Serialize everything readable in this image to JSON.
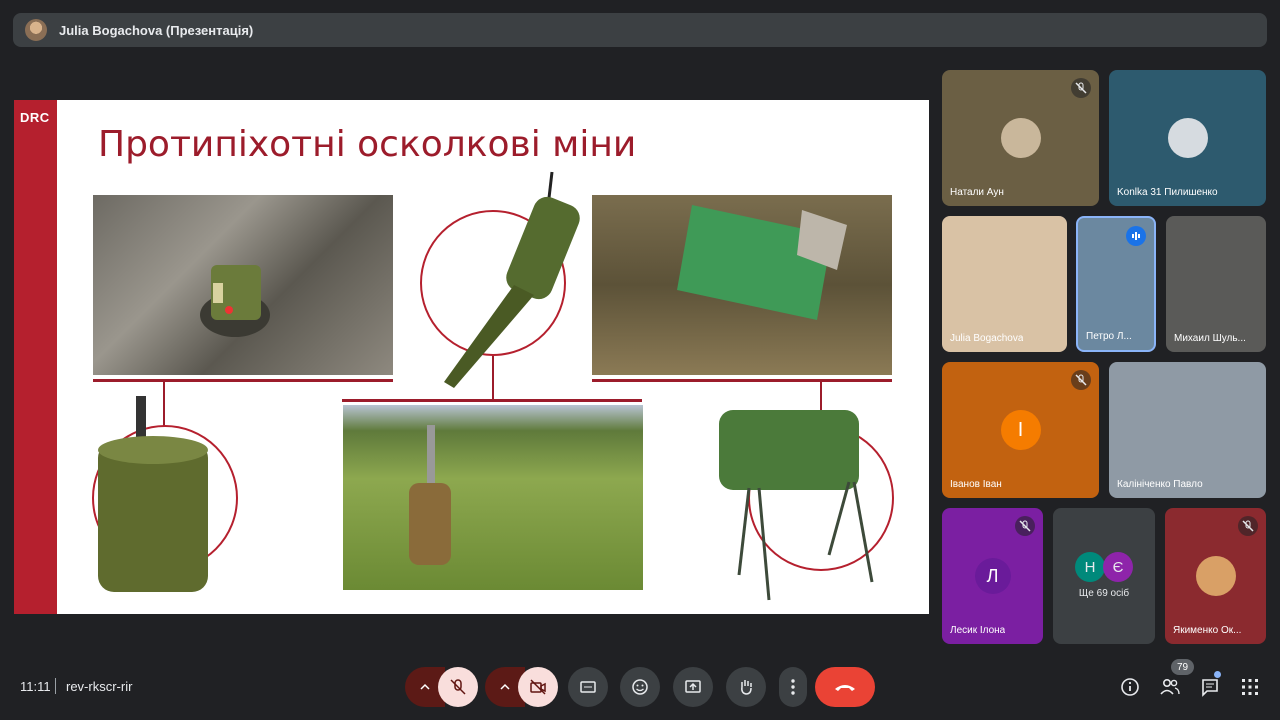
{
  "header": {
    "presenter": "Julia Bogachova (Презентація)"
  },
  "slide": {
    "logo": "DRC",
    "title": "Протипіхотні осколкові міни"
  },
  "participants": [
    {
      "name": "Натали Аун",
      "muted": true
    },
    {
      "name": "Konlka 31 Пилишенко",
      "muted": false
    },
    {
      "name": "Julia Bogachova",
      "muted": false
    },
    {
      "name": "Петро Л...",
      "speaking": true
    },
    {
      "name": "Михаил Шуль...",
      "muted": false
    },
    {
      "name": "Іванов Іван",
      "initial": "І",
      "muted": true
    },
    {
      "name": "Калініченко Павло",
      "muted": false
    },
    {
      "name": "Лесик Ілона",
      "initial": "Л",
      "muted": true
    },
    {
      "name": "Ще 69 осіб",
      "initials": [
        "Н",
        "Є"
      ]
    },
    {
      "name": "Якименко Ок...",
      "muted": true
    }
  ],
  "bottom": {
    "time": "11:11",
    "meeting_code": "rev-rkscr-rir",
    "people_count": "79"
  },
  "colors": {
    "accent_red": "#ea4335",
    "brand_red": "#b5202e",
    "tile_orange": "#c26210",
    "tile_purple": "#7b1fa2"
  }
}
